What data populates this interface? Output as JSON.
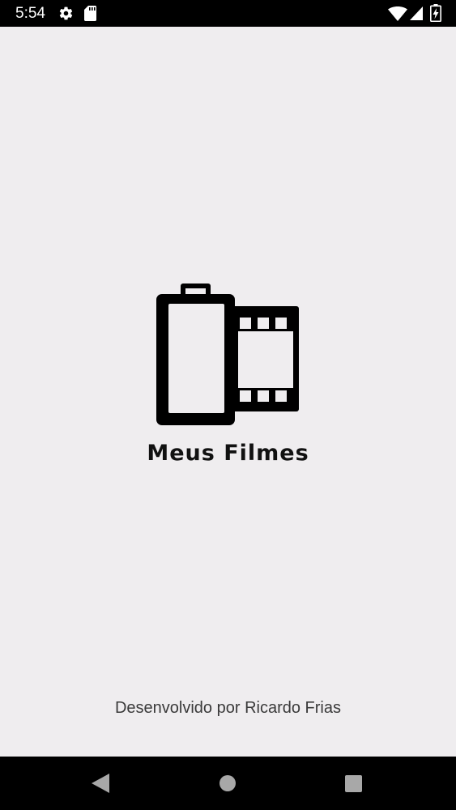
{
  "status_bar": {
    "time": "5:54",
    "icons": [
      "gear-icon",
      "sd-card-icon",
      "wifi-icon",
      "cell-signal-icon",
      "battery-charging-icon"
    ]
  },
  "splash": {
    "logo_icon": "film-roll-icon",
    "app_title": "Meus Filmes",
    "credit": "Desenvolvido por Ricardo Frias"
  },
  "nav_bar": {
    "icons": [
      "back-icon",
      "home-icon",
      "recents-icon"
    ]
  },
  "colors": {
    "background": "#efedef",
    "system_bars": "#000000",
    "title_text": "#111111",
    "credit_text": "#3a3a3a",
    "nav_icons": "#a8a8a8"
  }
}
